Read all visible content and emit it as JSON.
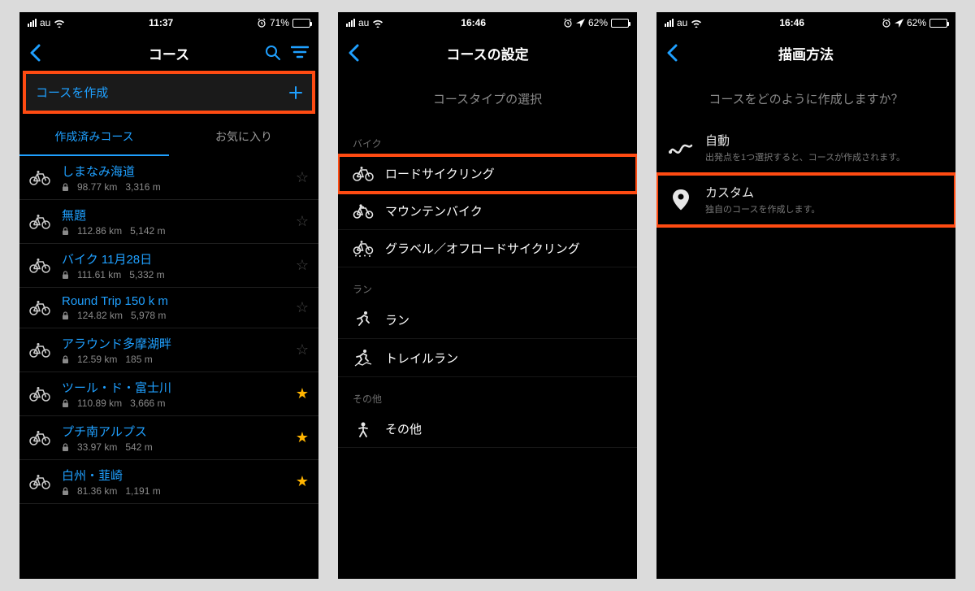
{
  "screens": [
    {
      "status": {
        "carrier": "au",
        "time": "11:37",
        "battery_pct": "71%",
        "show_location": false
      },
      "nav": {
        "title": "コース",
        "show_search": true,
        "show_filter": true
      },
      "create": {
        "label": "コースを作成"
      },
      "tabs": {
        "active": "作成済みコース",
        "other": "お気に入り"
      },
      "courses": [
        {
          "name": "しまなみ海道",
          "dist": "98.77 km",
          "elev": "3,316 m",
          "fav": false
        },
        {
          "name": "無題",
          "dist": "112.86 km",
          "elev": "5,142 m",
          "fav": false
        },
        {
          "name": "バイク 11月28日",
          "dist": "111.61 km",
          "elev": "5,332 m",
          "fav": false
        },
        {
          "name": "Round Trip 150 k m",
          "dist": "124.82 km",
          "elev": "5,978 m",
          "fav": false
        },
        {
          "name": "アラウンド多摩湖畔",
          "dist": "12.59 km",
          "elev": "185 m",
          "fav": false
        },
        {
          "name": "ツール・ド・富士川",
          "dist": "110.89 km",
          "elev": "3,666 m",
          "fav": true
        },
        {
          "name": "プチ南アルプス",
          "dist": "33.97 km",
          "elev": "542 m",
          "fav": true
        },
        {
          "name": "白州・韮崎",
          "dist": "81.36 km",
          "elev": "1,191 m",
          "fav": true
        }
      ]
    },
    {
      "status": {
        "carrier": "au",
        "time": "16:46",
        "battery_pct": "62%",
        "show_location": true
      },
      "nav": {
        "title": "コースの設定"
      },
      "subhead": "コースタイプの選択",
      "groups": [
        {
          "header": "バイク",
          "items": [
            {
              "label": "ロードサイクリング",
              "icon": "road-bike",
              "highlight": true
            },
            {
              "label": "マウンテンバイク",
              "icon": "mtb"
            },
            {
              "label": "グラベル／オフロードサイクリング",
              "icon": "gravel"
            }
          ]
        },
        {
          "header": "ラン",
          "items": [
            {
              "label": "ラン",
              "icon": "run"
            },
            {
              "label": "トレイルラン",
              "icon": "trail-run"
            }
          ]
        },
        {
          "header": "その他",
          "items": [
            {
              "label": "その他",
              "icon": "other"
            }
          ]
        }
      ]
    },
    {
      "status": {
        "carrier": "au",
        "time": "16:46",
        "battery_pct": "62%",
        "show_location": true
      },
      "nav": {
        "title": "描画方法"
      },
      "subhead": "コースをどのように作成しますか？",
      "options": [
        {
          "title": "自動",
          "desc": "出発点を1つ選択すると、コースが作成されます。",
          "icon": "auto",
          "highlight": false
        },
        {
          "title": "カスタム",
          "desc": "独自のコースを作成します。",
          "icon": "pin",
          "highlight": true
        }
      ]
    }
  ]
}
